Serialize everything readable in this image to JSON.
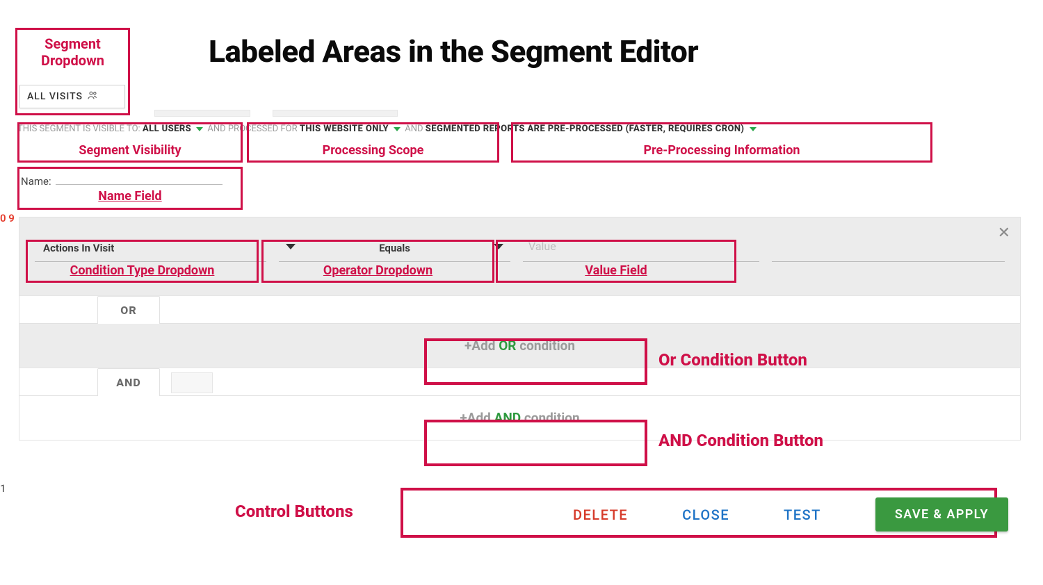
{
  "page": {
    "title": "Labeled Areas in the Segment Editor"
  },
  "segment_dropdown": {
    "label": "Segment\nDropdown",
    "selected": "ALL VISITS"
  },
  "metadata": {
    "visibility": {
      "prefix": "THIS SEGMENT IS VISIBLE TO:",
      "value": "ALL USERS",
      "label": "Segment Visibility"
    },
    "scope": {
      "prefix": "AND PROCESSED FOR",
      "value": "THIS WEBSITE ONLY",
      "label": "Processing Scope"
    },
    "preprocessing": {
      "prefix": "AND",
      "value": "SEGMENTED REPORTS ARE PRE-PROCESSED (FASTER, REQUIRES CRON)",
      "label": "Pre-Processing Information"
    }
  },
  "name_field": {
    "label": "Name:",
    "value": "",
    "annotation": "Name Field"
  },
  "condition": {
    "type": {
      "value": "Actions In Visit",
      "annotation": "Condition Type Dropdown"
    },
    "operator": {
      "value": "Equals",
      "annotation": "Operator Dropdown"
    },
    "value": {
      "placeholder": "Value",
      "value": "",
      "annotation": "Value Field"
    }
  },
  "logic": {
    "or": {
      "tab": "OR",
      "add_prefix": "+Add ",
      "add_kw": "OR",
      "add_suffix": " condition",
      "annotation": "Or Condition Button"
    },
    "and": {
      "tab": "AND",
      "add_prefix": "+Add ",
      "add_kw": "AND",
      "add_suffix": " condition",
      "annotation": "AND Condition Button"
    }
  },
  "controls": {
    "annotation": "Control Buttons",
    "delete": "DELETE",
    "close": "CLOSE",
    "test": "TEST",
    "save": "SAVE & APPLY"
  },
  "clipped": {
    "left": "0 9",
    "one": "1"
  }
}
